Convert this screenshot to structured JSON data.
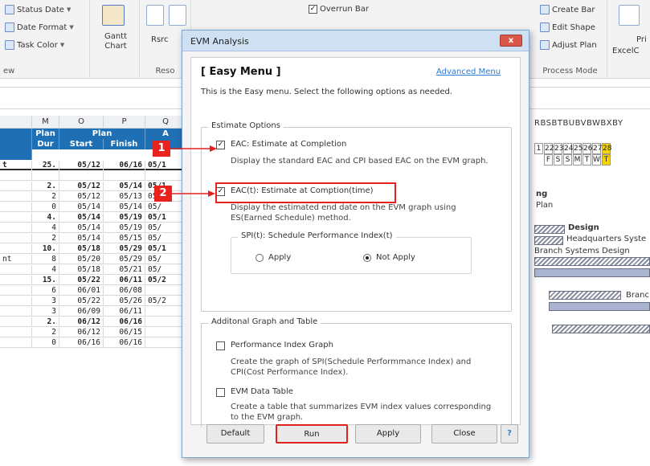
{
  "ribbon": {
    "status_date": "Status Date",
    "date_format": "Date Format",
    "task_color": "Task Color",
    "gantt_chart": "Gantt Chart",
    "rsrc": "Rsrc",
    "overrun_bar": "Overrun Bar",
    "create_bar": "Create Bar",
    "edit_shape": "Edit Shape",
    "adjust_plan": "Adjust Plan",
    "process_mode": "Process Mode",
    "group_view": "ew",
    "group_reso": "Reso",
    "pri": "Pri",
    "excelc": "ExcelC"
  },
  "sheet": {
    "col_m": "M",
    "col_o": "O",
    "col_p": "P",
    "col_q": "Q",
    "plan": "Plan",
    "plan_dur": "Plan",
    "dur": "Dur",
    "start": "Start",
    "finish": "Finish",
    "a": "A",
    "rows": [
      {
        "dur": "25.",
        "start": "05/12",
        "finish": "06/16",
        "q": "05/1",
        "bold": true,
        "sep": true,
        "lead": "t"
      },
      {
        "dur": "",
        "start": "",
        "finish": "",
        "q": "",
        "bold": false,
        "sep": false,
        "lead": ""
      },
      {
        "dur": "2.",
        "start": "05/12",
        "finish": "05/14",
        "q": "05/1",
        "bold": true,
        "sep": false,
        "lead": ""
      },
      {
        "dur": "2",
        "start": "05/12",
        "finish": "05/13",
        "q": "05/",
        "bold": false,
        "sep": false,
        "lead": ""
      },
      {
        "dur": "0",
        "start": "05/14",
        "finish": "05/14",
        "q": "05/",
        "bold": false,
        "sep": false,
        "lead": ""
      },
      {
        "dur": "4.",
        "start": "05/14",
        "finish": "05/19",
        "q": "05/1",
        "bold": true,
        "sep": false,
        "lead": ""
      },
      {
        "dur": "4",
        "start": "05/14",
        "finish": "05/19",
        "q": "05/",
        "bold": false,
        "sep": false,
        "lead": ""
      },
      {
        "dur": "2",
        "start": "05/14",
        "finish": "05/15",
        "q": "05/",
        "bold": false,
        "sep": false,
        "lead": ""
      },
      {
        "dur": "10.",
        "start": "05/18",
        "finish": "05/29",
        "q": "05/1",
        "bold": true,
        "sep": false,
        "lead": ""
      },
      {
        "dur": "8",
        "start": "05/20",
        "finish": "05/29",
        "q": "05/",
        "bold": false,
        "sep": false,
        "lead": "nt"
      },
      {
        "dur": "4",
        "start": "05/18",
        "finish": "05/21",
        "q": "05/",
        "bold": false,
        "sep": false,
        "lead": ""
      },
      {
        "dur": "15.",
        "start": "05/22",
        "finish": "06/11",
        "q": "05/2",
        "bold": true,
        "sep": false,
        "lead": ""
      },
      {
        "dur": "6",
        "start": "06/01",
        "finish": "06/08",
        "q": "",
        "bold": false,
        "sep": false,
        "lead": ""
      },
      {
        "dur": "3",
        "start": "05/22",
        "finish": "05/26",
        "q": "05/2",
        "bold": false,
        "sep": false,
        "lead": ""
      },
      {
        "dur": "3",
        "start": "06/09",
        "finish": "06/11",
        "q": "",
        "bold": false,
        "sep": false,
        "lead": ""
      },
      {
        "dur": "2.",
        "start": "06/12",
        "finish": "06/16",
        "q": "",
        "bold": true,
        "sep": false,
        "lead": ""
      },
      {
        "dur": "2",
        "start": "06/12",
        "finish": "06/15",
        "q": "",
        "bold": false,
        "sep": false,
        "lead": ""
      },
      {
        "dur": "0",
        "start": "06/16",
        "finish": "06/16",
        "q": "",
        "bold": false,
        "sep": false,
        "lead": ""
      }
    ]
  },
  "gantt": {
    "col_header": "RBSBTBUBVBWBXBY",
    "days_num": [
      "1",
      "22",
      "23",
      "24",
      "25",
      "26",
      "27",
      "28"
    ],
    "days_dow": [
      "F",
      "S",
      "S",
      "M",
      "T",
      "W",
      "T"
    ],
    "label_ng": "ng",
    "label_plan": "Plan",
    "label_design": "Design",
    "label_hq": "Headquarters Syste",
    "label_branch": "Branch Systems Design",
    "label_branc": "Branc"
  },
  "dialog": {
    "title": "EVM Analysis",
    "close": "x",
    "heading": "[ Easy Menu ]",
    "advanced_link": "Advanced Menu",
    "intro": "This is the Easy menu. Select the following options as needed.",
    "estimate_options": "Estimate Options",
    "eac_label": "EAC: Estimate at Completion",
    "eac_desc": "Display the standard EAC and CPI based EAC on the EVM graph.",
    "eact_label": "EAC(t): Estimate at Comption(time)",
    "eact_desc": "Display the estimated end date on the EVM graph using ES(Earned Schedule) method.",
    "spi_legend": "SPI(t): Schedule Performance Index(t)",
    "apply_radio": "Apply",
    "not_apply_radio": "Not Apply",
    "additional": "Additonal Graph and Table",
    "perf_label": "Performance Index Graph",
    "perf_desc": "Create the graph of SPI(Schedule Performmance Index) and CPI(Cost Performance Index).",
    "evm_table_label": "EVM Data Table",
    "evm_table_desc": "Create a table that summarizes EVM index values corresponding to the EVM graph.",
    "btn_default": "Default",
    "btn_run": "Run",
    "btn_apply": "Apply",
    "btn_close": "Close",
    "btn_help": "?"
  },
  "callouts": {
    "one": "1",
    "two": "2"
  },
  "colors": {
    "header_blue": "#1f6fb5",
    "highlight_red": "#e0231f",
    "link_blue": "#2a7bd1"
  }
}
